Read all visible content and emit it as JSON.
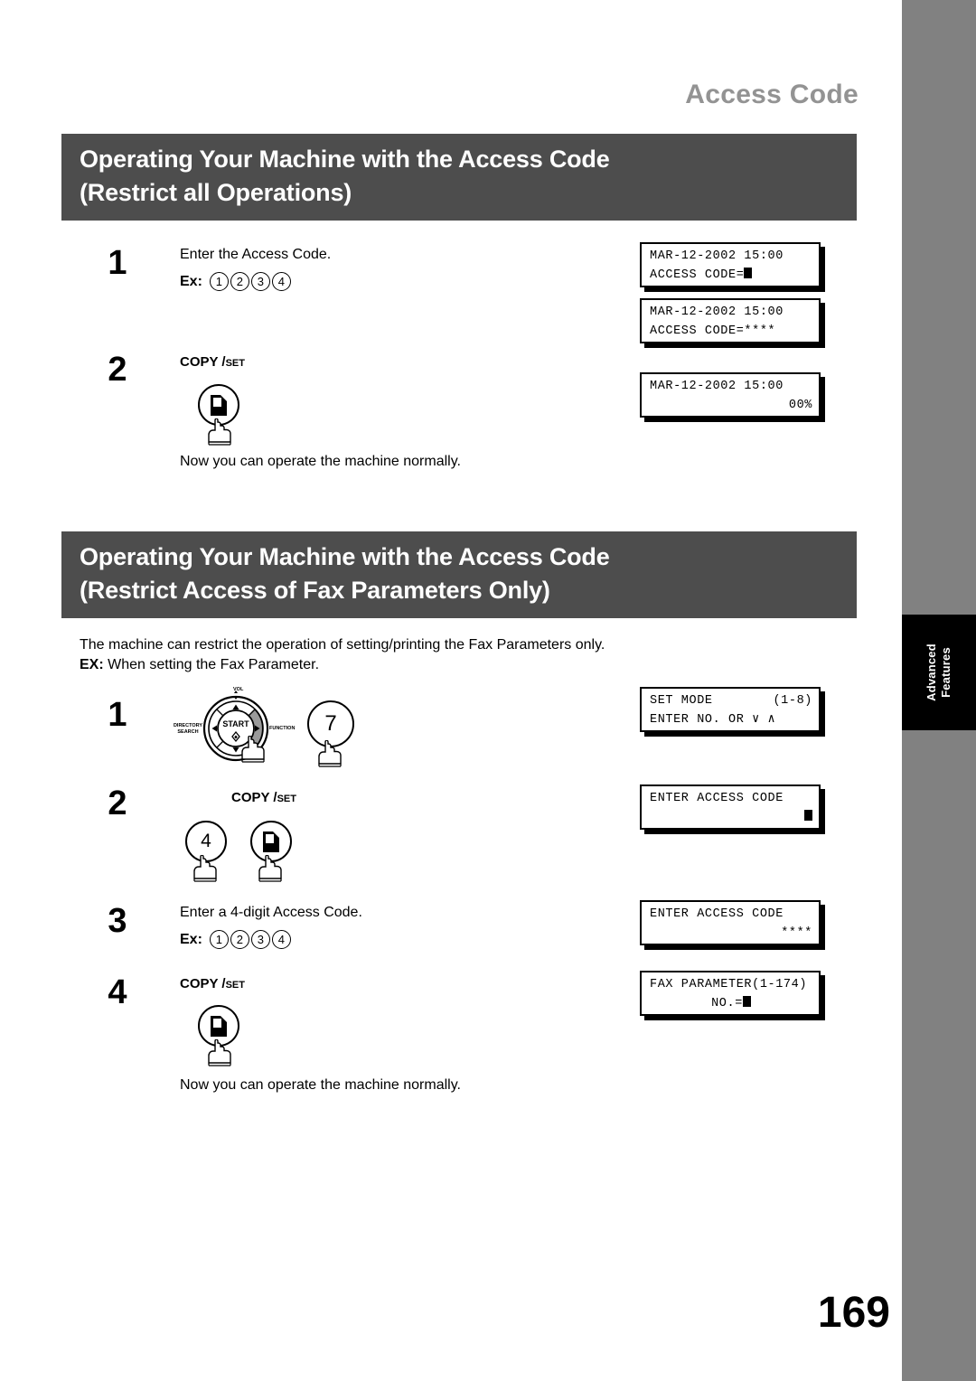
{
  "running_header": "Access Code",
  "page_number": "169",
  "side_tab": {
    "line1": "Advanced",
    "line2": "Features"
  },
  "colors": {
    "heading_bar": "#4d4d4d",
    "running_header": "#939393",
    "right_strip": "#818181",
    "side_tab_bg": "#000000"
  },
  "section1": {
    "heading_line1": "Operating Your Machine with the Access Code",
    "heading_line2": "(Restrict all Operations)",
    "step1": {
      "number": "1",
      "text": "Enter the Access Code.",
      "ex_label": "Ex:",
      "ex_digits": [
        "1",
        "2",
        "3",
        "4"
      ]
    },
    "step2": {
      "number": "2",
      "key_label_main": "COPY /",
      "key_label_small": "SET",
      "key_icon": "copy-set-page-icon"
    },
    "closing_text": "Now you can operate the machine normally.",
    "displays": [
      {
        "line1": "MAR-12-2002 15:00",
        "line2_prefix": "ACCESS CODE=",
        "line2_cursor": true
      },
      {
        "line1": "MAR-12-2002 15:00",
        "line2_prefix": "ACCESS CODE=****",
        "line2_cursor": false
      },
      {
        "line1": "MAR-12-2002 15:00",
        "line2_right": "00%",
        "line2_cursor": false
      }
    ]
  },
  "section2": {
    "heading_line1": "Operating Your Machine with the Access Code",
    "heading_line2": "(Restrict Access of Fax Parameters Only)",
    "intro_line1": "The machine can restrict the operation of setting/printing the Fax Parameters only.",
    "intro_ex_label": "EX:",
    "intro_line2": "When setting the Fax Parameter.",
    "step1": {
      "number": "1",
      "navpad": {
        "center": "START",
        "top": "VOL",
        "left_line1": "DIRECTORY",
        "left_line2": "SEARCH",
        "right": "FUNCTION"
      },
      "key_digit": "7"
    },
    "step2": {
      "number": "2",
      "key_label_main": "COPY /",
      "key_label_small": "SET",
      "key_digit": "4",
      "key_icon": "copy-set-page-icon"
    },
    "step3": {
      "number": "3",
      "text": "Enter a 4-digit Access Code.",
      "ex_label": "Ex:",
      "ex_digits": [
        "1",
        "2",
        "3",
        "4"
      ]
    },
    "step4": {
      "number": "4",
      "key_label_main": "COPY /",
      "key_label_small": "SET",
      "key_icon": "copy-set-page-icon"
    },
    "closing_text": "Now you can operate the machine normally.",
    "displays": [
      {
        "line1_left": "SET MODE",
        "line1_right": "(1-8)",
        "line2": "ENTER NO. OR ∨ ∧"
      },
      {
        "line1": "ENTER ACCESS CODE",
        "line2_cursor": true
      },
      {
        "line1": "ENTER ACCESS CODE",
        "line2_right": "****"
      },
      {
        "line1": "FAX PARAMETER(1-174)",
        "line2_center_prefix": "NO.=",
        "line2_cursor": true
      }
    ]
  }
}
